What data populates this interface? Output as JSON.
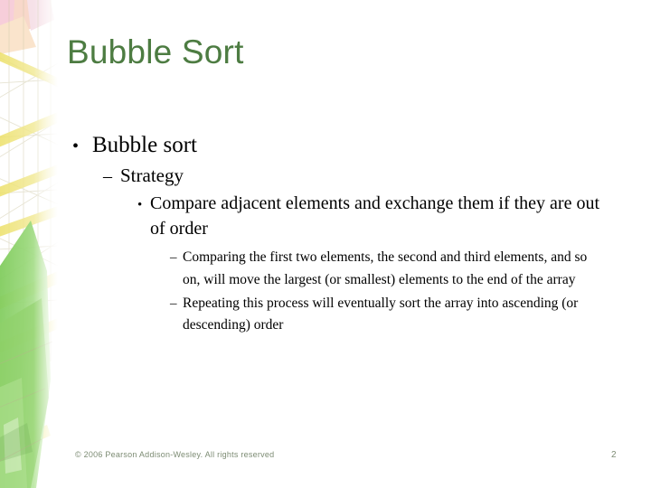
{
  "slide": {
    "title": "Bubble Sort",
    "title_color": "#4d7c42",
    "background_color": "#ffffff",
    "body_text_color": "#000000"
  },
  "content": {
    "level1": {
      "marker": "•",
      "text": "Bubble sort"
    },
    "level2": {
      "marker": "–",
      "text": "Strategy"
    },
    "level3": {
      "marker": "•",
      "text": "Compare adjacent elements and exchange them if they are out of order"
    },
    "level4": [
      {
        "marker": "–",
        "text": "Comparing the first two elements, the second and third elements, and so on, will move the largest (or smallest) elements to the end of the array"
      },
      {
        "marker": "–",
        "text": "Repeating this process will eventually sort the array into ascending (or descending) order"
      }
    ]
  },
  "footer": {
    "copyright": "© 2006 Pearson Addison-Wesley. All rights reserved",
    "page_number": "2",
    "color": "#7d8c74"
  },
  "decoration": {
    "name": "scaffolding-lattice-graphic",
    "colors": {
      "green": "#8fd169",
      "yellow": "#f2ea8a",
      "pink": "#f0b9c8",
      "orange": "#f5c08a",
      "lattice_line": "#cfc9a8"
    }
  }
}
